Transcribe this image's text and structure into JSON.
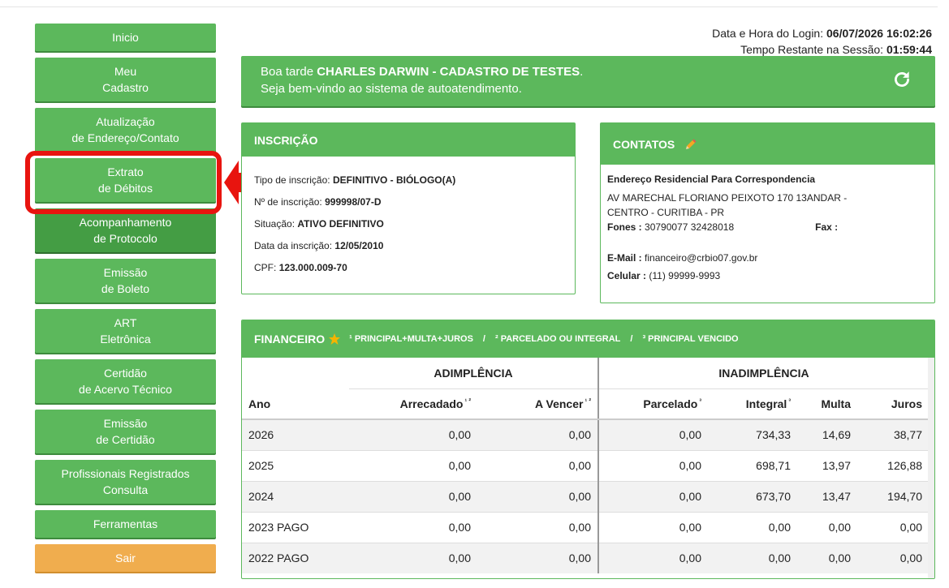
{
  "sidebar": {
    "items": [
      {
        "line1": "Inicio",
        "line2": ""
      },
      {
        "line1": "Meu",
        "line2": "Cadastro"
      },
      {
        "line1": "Atualização",
        "line2": "de Endereço/Contato"
      },
      {
        "line1": "Extrato",
        "line2": "de Débitos"
      },
      {
        "line1": "Acompanhamento",
        "line2": "de Protocolo"
      },
      {
        "line1": "Emissão",
        "line2": "de Boleto"
      },
      {
        "line1": "ART",
        "line2": "Eletrônica"
      },
      {
        "line1": "Certidão",
        "line2": "de Acervo Técnico"
      },
      {
        "line1": "Emissão",
        "line2": "de Certidão"
      },
      {
        "line1": "Profissionais Registrados",
        "line2": "Consulta"
      },
      {
        "line1": "Ferramentas",
        "line2": ""
      },
      {
        "line1": "Sair",
        "line2": ""
      }
    ]
  },
  "login": {
    "label1": "Data e Hora do Login:",
    "value1": "06/07/2026 16:02:26",
    "label2": "Tempo Restante na Sessão:",
    "value2": "01:59:44"
  },
  "welcome": {
    "greeting": "Boa tarde",
    "name": "CHARLES DARWIN - CADASTRO DE TESTES",
    "punct": ".",
    "line2": "Seja bem-vindo ao sistema de autoatendimento."
  },
  "inscricao": {
    "title": "INSCRIÇÃO",
    "fields": [
      {
        "label": "Tipo de inscrição:",
        "value": "DEFINITIVO - BIÓLOGO(A)"
      },
      {
        "label": "Nº de inscrição:",
        "value": "999998/07-D"
      },
      {
        "label": "Situação:",
        "value": "ATIVO DEFINITIVO"
      },
      {
        "label": "Data da inscrição:",
        "value": "12/05/2010"
      },
      {
        "label": "CPF:",
        "value": "123.000.009-70"
      }
    ]
  },
  "contatos": {
    "title": "CONTATOS",
    "address_title": "Endereço Residencial Para Correspondencia",
    "address_line1": "AV MARECHAL FLORIANO PEIXOTO 170 13ANDAR -",
    "address_line2": "CENTRO - CURITIBA - PR",
    "fones_label": "Fones :",
    "fones_value": "30790077 32428018",
    "fax_label": "Fax :",
    "email_label": "E-Mail :",
    "email_value": "financeiro@crbio07.gov.br",
    "celular_label": "Celular :",
    "celular_value": "(11) 99999-9993"
  },
  "financeiro": {
    "title": "FINANCEIRO",
    "note1": "¹ PRINCIPAL+MULTA+JUROS",
    "note2": "² PARCELADO OU INTEGRAL",
    "note3": "³ PRINCIPAL VENCIDO",
    "sep": "/",
    "group1": "ADIMPLÊNCIA",
    "group2": "INADIMPLÊNCIA",
    "columns": {
      "ano": "Ano",
      "arrecadado": "Arrecadado",
      "arrecadado_sup": "¹ ²",
      "a_vencer": "A Vencer",
      "a_vencer_sup": "¹ ²",
      "parcelado": "Parcelado",
      "parcelado_sup": "³",
      "integral": "Integral",
      "integral_sup": "³",
      "multa": "Multa",
      "juros": "Juros"
    },
    "rows": [
      {
        "ano": "2026",
        "arrecadado": "0,00",
        "a_vencer": "0,00",
        "parcelado": "0,00",
        "integral": "734,33",
        "multa": "14,69",
        "juros": "38,77"
      },
      {
        "ano": "2025",
        "arrecadado": "0,00",
        "a_vencer": "0,00",
        "parcelado": "0,00",
        "integral": "698,71",
        "multa": "13,97",
        "juros": "126,88"
      },
      {
        "ano": "2024",
        "arrecadado": "0,00",
        "a_vencer": "0,00",
        "parcelado": "0,00",
        "integral": "673,70",
        "multa": "13,47",
        "juros": "194,70"
      },
      {
        "ano": "2023 PAGO",
        "arrecadado": "0,00",
        "a_vencer": "0,00",
        "parcelado": "0,00",
        "integral": "0,00",
        "multa": "0,00",
        "juros": "0,00"
      },
      {
        "ano": "2022 PAGO",
        "arrecadado": "0,00",
        "a_vencer": "0,00",
        "parcelado": "0,00",
        "integral": "0,00",
        "multa": "0,00",
        "juros": "0,00"
      }
    ]
  },
  "colors": {
    "primary_green": "#5cb85c",
    "active_green": "#449d44",
    "warning_orange": "#f0ad4e",
    "highlight_red": "#e8140f"
  }
}
